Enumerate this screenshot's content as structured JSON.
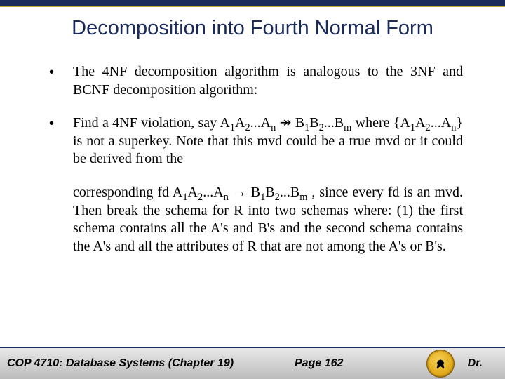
{
  "slide": {
    "title": "Decomposition into Fourth Normal Form",
    "bullet1": "The 4NF decomposition algorithm is analogous to the 3NF and BCNF decomposition algorithm:",
    "bullet2_prefix": "Find a 4NF violation, say A",
    "sub1": "1",
    "bullet2_a2": "A",
    "sub2": "2",
    "bullet2_dots1": "...A",
    "subn": "n",
    "bullet2_arrow": " ↠ B",
    "subb1": "1",
    "bullet2_b2": "B",
    "subb2": "2",
    "bullet2_dots2": "...B",
    "subm": "m",
    "bullet2_mid1": "  where {A",
    "bullet2_mid2": "} is not a superkey.  Note that this mvd could be a true mvd or it could be derived from the",
    "cont_pref": "corresponding fd A",
    "cont_arrow": " → B",
    "cont_tail": " , since every fd is an mvd.    Then break the schema for R into two schemas where: (1) the first schema contains all the A's and B's and the second schema contains the A's and all the attributes of R that are not among the A's or B's."
  },
  "footer": {
    "course": "COP 4710: Database Systems  (Chapter 19)",
    "page": "Page 162",
    "author": "Dr."
  }
}
